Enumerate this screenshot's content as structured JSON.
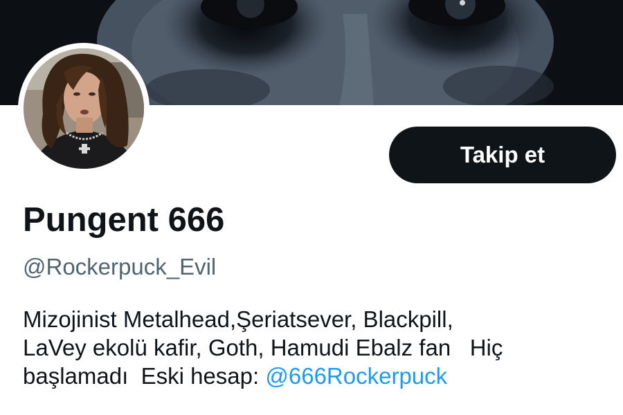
{
  "profile": {
    "display_name": "Pungent 666",
    "handle": "@Rockerpuck_Evil",
    "follow_label": "Takip et",
    "bio": {
      "line1": "Mizojinist Metalhead,Şeriatsever, Blackpill,",
      "line2": "LaVey ekolü kafir, Goth, Hamudi Ebalz fan   Hiç",
      "line3_text": "başlamadı  Eski hesap: ",
      "line3_link": "@666Rockerpuck"
    }
  },
  "colors": {
    "text_primary": "#0f1419",
    "text_secondary": "#536471",
    "link": "#1d9bf0",
    "button_bg": "#0f1419",
    "button_text": "#ffffff",
    "page_bg": "#ffffff"
  },
  "images": {
    "banner": "dark-face-closeup",
    "avatar": "long-haired-man-portrait"
  }
}
